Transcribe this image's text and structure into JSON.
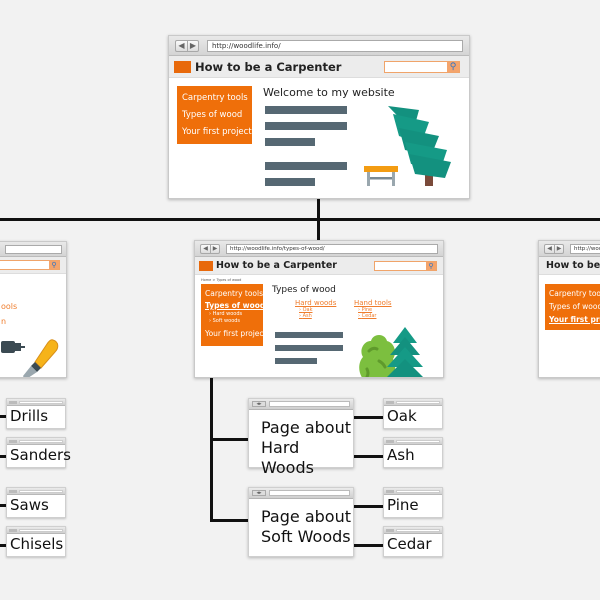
{
  "colors": {
    "accent": "#ef6f0a",
    "link": "#ef7d2d",
    "bar": "#566873",
    "tree_teal": "#159a86",
    "bush_green": "#7cbf3f",
    "background": "#f2f2f2"
  },
  "home": {
    "url": "http://woodlife.info/",
    "site_title": "How to be a Carpenter",
    "heading": "Welcome to my website",
    "nav": [
      "Carpentry tools",
      "Types of wood",
      "Your first project"
    ]
  },
  "left_page": {
    "nav_partial": [
      "ools",
      "n"
    ]
  },
  "center_page": {
    "url": "http://woodlife.info/types-of-wood/",
    "site_title": "How to be a Carpenter",
    "breadcrumb": "Home > Types of wood",
    "heading": "Types of wood",
    "nav": {
      "tools": "Carpentry tools",
      "wood": "Types of wood",
      "sub": [
        "Hard woods",
        "Soft woods"
      ],
      "project": "Your first project"
    },
    "columns": [
      {
        "title": "Hard woods",
        "items": [
          "Oak",
          "Ash"
        ]
      },
      {
        "title": "Hand tools",
        "items": [
          "Pine",
          "Cedar"
        ]
      }
    ]
  },
  "right_page": {
    "url": "http://woodlife.info/",
    "site_title": "How to be a Carpenter",
    "nav": [
      "Carpentry tools",
      "Types of wood",
      "Your first project"
    ]
  },
  "tool_pages": [
    "Drills",
    "Sanders",
    "Saws",
    "Chisels"
  ],
  "wood_pages": [
    {
      "label_line1": "Page about",
      "label_line2": "Hard Woods",
      "children": [
        "Oak",
        "Ash"
      ]
    },
    {
      "label_line1": "Page about",
      "label_line2": "Soft Woods",
      "children": [
        "Pine",
        "Cedar"
      ]
    }
  ]
}
